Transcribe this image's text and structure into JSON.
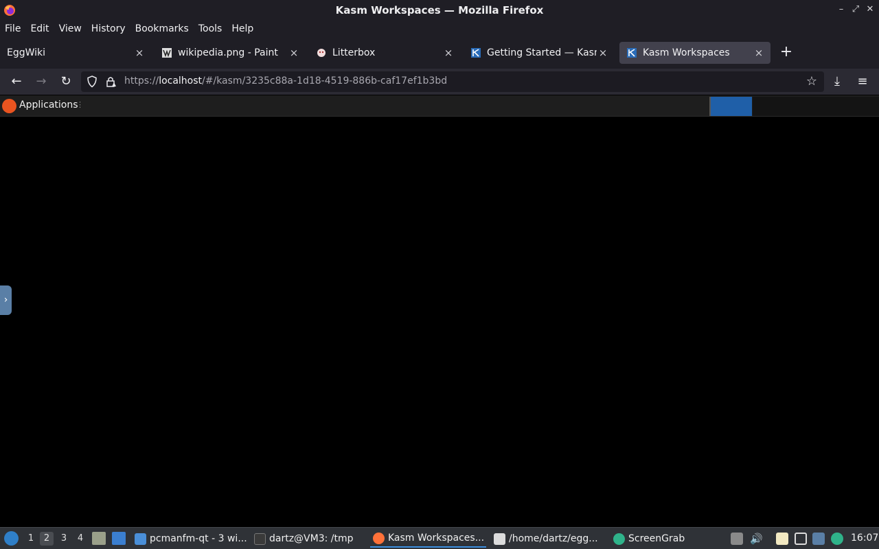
{
  "window": {
    "title": "Kasm Workspaces — Mozilla Firefox",
    "controls": {
      "minimize": "–",
      "maximize": "⤢",
      "close": "✕"
    }
  },
  "menubar": [
    "File",
    "Edit",
    "View",
    "History",
    "Bookmarks",
    "Tools",
    "Help"
  ],
  "tabs": [
    {
      "label": "EggWiki",
      "icon": "none",
      "active": false
    },
    {
      "label": "wikipedia.png - Paint",
      "icon": "wikipedia-icon",
      "active": false
    },
    {
      "label": "Litterbox",
      "icon": "litterbox-icon",
      "active": false
    },
    {
      "label": "Getting Started — Kasm",
      "icon": "kasm-icon",
      "active": false
    },
    {
      "label": "Kasm Workspaces",
      "icon": "kasm-icon",
      "active": true
    }
  ],
  "tab_close_glyph": "×",
  "new_tab_glyph": "+",
  "nav": {
    "back": "←",
    "forward": "→",
    "reload": "↻",
    "url_prefix": "https://",
    "url_host": "localhost",
    "url_path": "/#/kasm/3235c88a-1d18-4519-886b-caf17ef1b3bd",
    "bookmark_star": "☆",
    "downloads": "⤓",
    "menu": "≡"
  },
  "kasm_bar": {
    "applications_label": "Applications",
    "more_glyph": "⋮"
  },
  "side_handle_glyph": "›",
  "taskbar": {
    "desktops": [
      "1",
      "2",
      "3",
      "4"
    ],
    "active_desktop": "2",
    "tasks": [
      {
        "label": "pcmanfm-qt - 3 wi...",
        "icon": "folder-icon"
      },
      {
        "label": "dartz@VM3: /tmp",
        "icon": "terminal-icon"
      },
      {
        "label": "Kasm Workspaces...",
        "icon": "firefox-icon",
        "active": true
      },
      {
        "label": "/home/dartz/egg...",
        "icon": "editor-icon"
      },
      {
        "label": "ScreenGrab",
        "icon": "screengrab-icon"
      }
    ],
    "clock": "16:07"
  },
  "colors": {
    "chrome_bg": "#1f1e25",
    "toolbar_bg": "#2b2a33",
    "active_tab": "#42414d",
    "kasm_accent": "#1f5fa8",
    "taskbar_bg": "#2f3237"
  }
}
